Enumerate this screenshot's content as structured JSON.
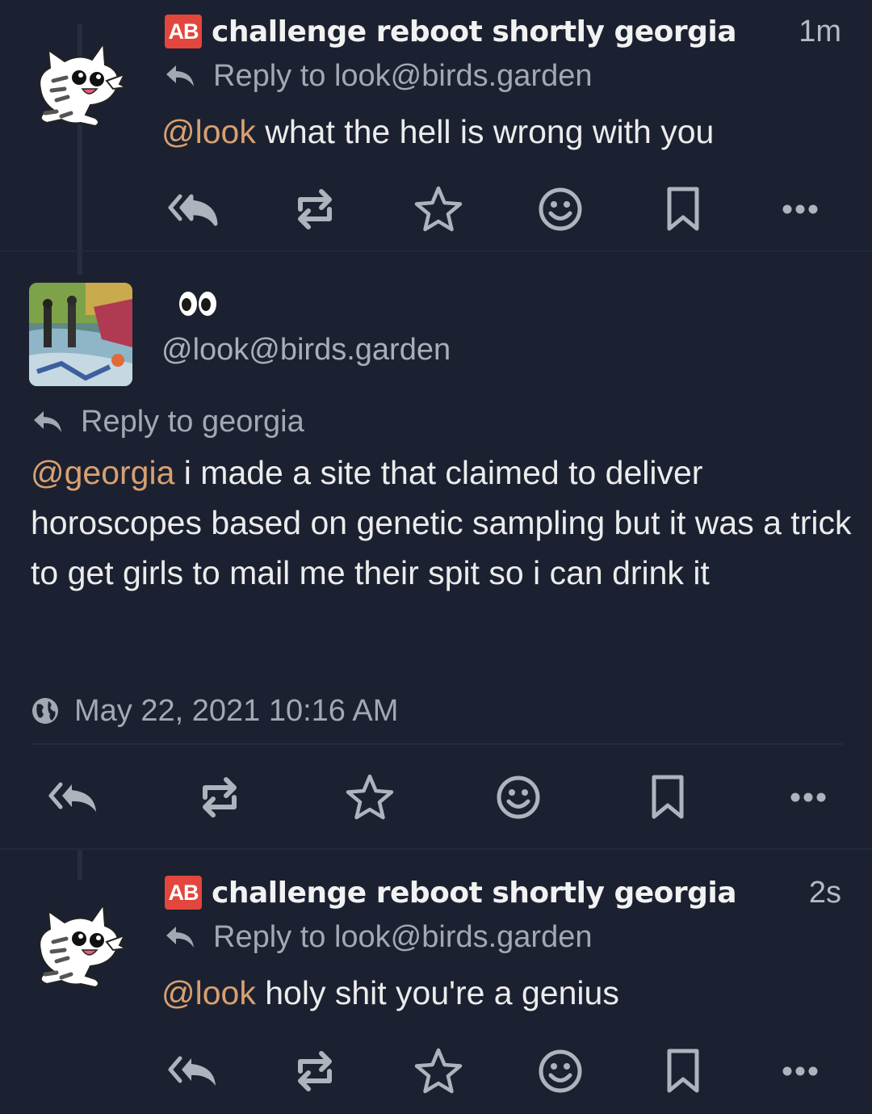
{
  "posts": [
    {
      "display_name": "challenge reboot shortly georgia",
      "badge": "AB",
      "time": "1m",
      "reply_to": "Reply to look@birds.garden",
      "mention": "@look",
      "text": " what the hell is wrong with you",
      "avatar": "cat-avatar"
    },
    {
      "display_name_emoji": "eyes",
      "handle": "@look@birds.garden",
      "reply_to": "Reply to georgia",
      "mention": "@georgia",
      "text": " i made a site that claimed to deliver horoscopes based on genetic sampling but it was a trick to get girls to mail me their spit so i can drink it",
      "timestamp": "May 22, 2021 10:16 AM",
      "avatar": "painting-avatar"
    },
    {
      "display_name": "challenge reboot shortly georgia",
      "badge": "AB",
      "time": "2s",
      "reply_to": "Reply to look@birds.garden",
      "mention": "@look",
      "text": " holy shit you're a genius",
      "avatar": "cat-avatar"
    }
  ],
  "icons": [
    "reply-all-icon",
    "boost-icon",
    "star-icon",
    "emoji-icon",
    "bookmark-icon",
    "more-icon"
  ],
  "colors": {
    "background": "#1b2130",
    "mention": "#d8a070",
    "badge": "#e2463d",
    "icon": "#aeb3bd"
  }
}
